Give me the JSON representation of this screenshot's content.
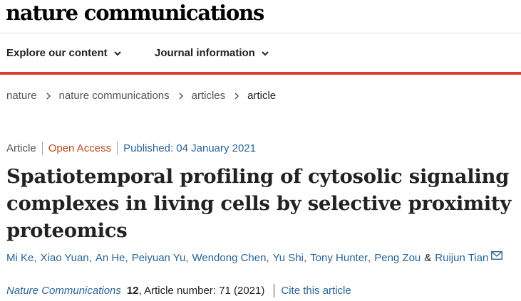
{
  "site": {
    "logo": "nature communications"
  },
  "nav": {
    "items": [
      {
        "label": "Explore our content"
      },
      {
        "label": "Journal information"
      }
    ],
    "accent_color": "#e0392f"
  },
  "breadcrumb": {
    "items": [
      "nature",
      "nature communications",
      "articles",
      "article"
    ]
  },
  "meta": {
    "type": "Article",
    "access": "Open Access",
    "published": "Published: 04 January 2021"
  },
  "article": {
    "title_lines": [
      "Spatiotemporal profiling of cytosolic signaling",
      "complexes in living cells by selective proximity",
      "proteomics"
    ]
  },
  "authors": {
    "list": [
      "Mi Ke",
      "Xiao Yuan",
      "An He",
      "Peiyuan Yu",
      "Wendong Chen",
      "Yu Shi",
      "Tony Hunter",
      "Peng Zou"
    ],
    "separator": ",",
    "ampersand": "&",
    "last": "Ruijun Tian",
    "corresponding_icon": "mail-icon"
  },
  "citation": {
    "journal": "Nature Communications",
    "volume": "12",
    "details": ", Article number: 71 (2021)",
    "cite_link": "Cite this article"
  },
  "colors": {
    "link": "#2a6496",
    "open_access": "#b84a1b",
    "text": "#222222"
  }
}
